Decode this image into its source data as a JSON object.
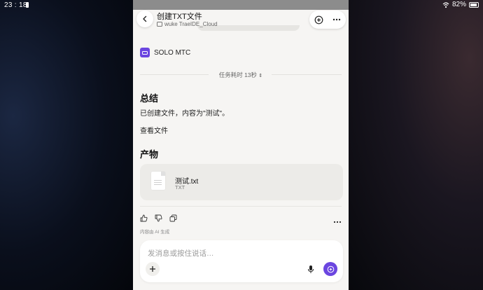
{
  "status_bar": {
    "time": "23 : 18",
    "battery": "82%"
  },
  "header": {
    "title": "创建TXT文件",
    "subtitle": "wuke TraeIDE_Cloud"
  },
  "agent": {
    "name": "SOLO MTC",
    "accent": "#6b46e0"
  },
  "task": {
    "duration": "任务耗时 13秒"
  },
  "summary": {
    "heading": "总结",
    "text": "已创建文件，内容为\"测试\"。",
    "view_file": "查看文件"
  },
  "artifacts": {
    "heading": "产物",
    "file": {
      "name": "测试.txt",
      "type": "TXT"
    }
  },
  "footer": {
    "ai_note": "内容由 AI 生成"
  },
  "composer": {
    "placeholder": "发消息或按住说话…"
  },
  "icons": [
    "back-icon",
    "new-chat-icon",
    "more-icon",
    "folder-icon",
    "thumbs-up-icon",
    "thumbs-down-icon",
    "copy-icon",
    "plus-icon",
    "mic-icon",
    "send-icon"
  ]
}
